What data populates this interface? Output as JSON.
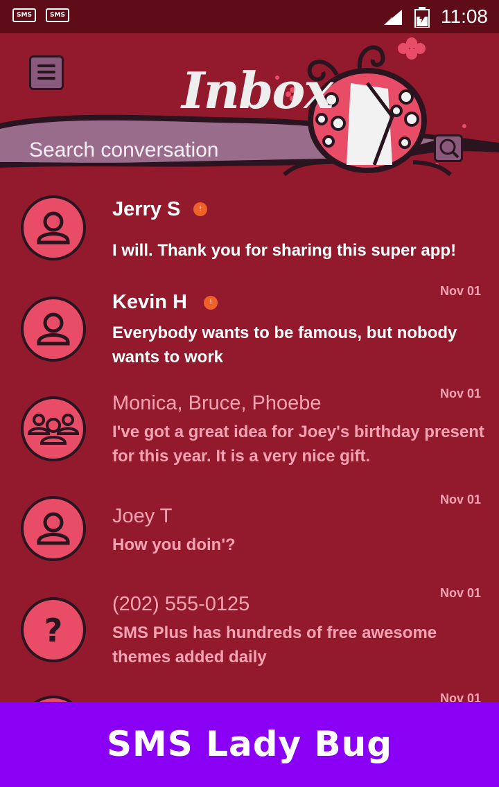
{
  "status_bar": {
    "time": "11:08",
    "notification_icons": [
      "SMS",
      "SMS"
    ]
  },
  "header": {
    "title": "Inbox",
    "search_placeholder": "Search conversation",
    "menu_icon": "menu-icon",
    "search_icon": "search-icon",
    "mascot": "ladybug"
  },
  "conversations": [
    {
      "name": "Jerry S",
      "message": "I will. Thank you for sharing this super app!",
      "date": "",
      "unread": true,
      "unread_mark": "!",
      "avatar": "person-icon"
    },
    {
      "name": "Kevin H",
      "message": "Everybody wants to be famous, but nobody wants to work",
      "date": "Nov 01",
      "unread": true,
      "unread_mark": "!",
      "avatar": "person-icon"
    },
    {
      "name": "Monica, Bruce, Phoebe",
      "message": "I've got a great idea for Joey's birthday present for this year. It is a very nice gift.",
      "date": "Nov 01",
      "unread": false,
      "avatar": "group-icon"
    },
    {
      "name": "Joey T",
      "message": "How you doin'?",
      "date": "Nov 01",
      "unread": false,
      "avatar": "person-icon"
    },
    {
      "name": "(202) 555-0125",
      "message": "SMS Plus has hundreds of free awesome themes added daily",
      "date": "Nov 01",
      "unread": false,
      "avatar": "question-icon"
    },
    {
      "name": "",
      "message": "",
      "date": "Nov 01",
      "unread": false,
      "avatar": "person-icon"
    }
  ],
  "banner": {
    "text": "SMS Lady Bug"
  },
  "colors": {
    "background": "#931a2d",
    "status_bar": "#5e0d18",
    "avatar_fill": "#e84c66",
    "read_text": "#f5a3b3",
    "unread_dot": "#f0612a",
    "banner": "#8a00f5"
  }
}
